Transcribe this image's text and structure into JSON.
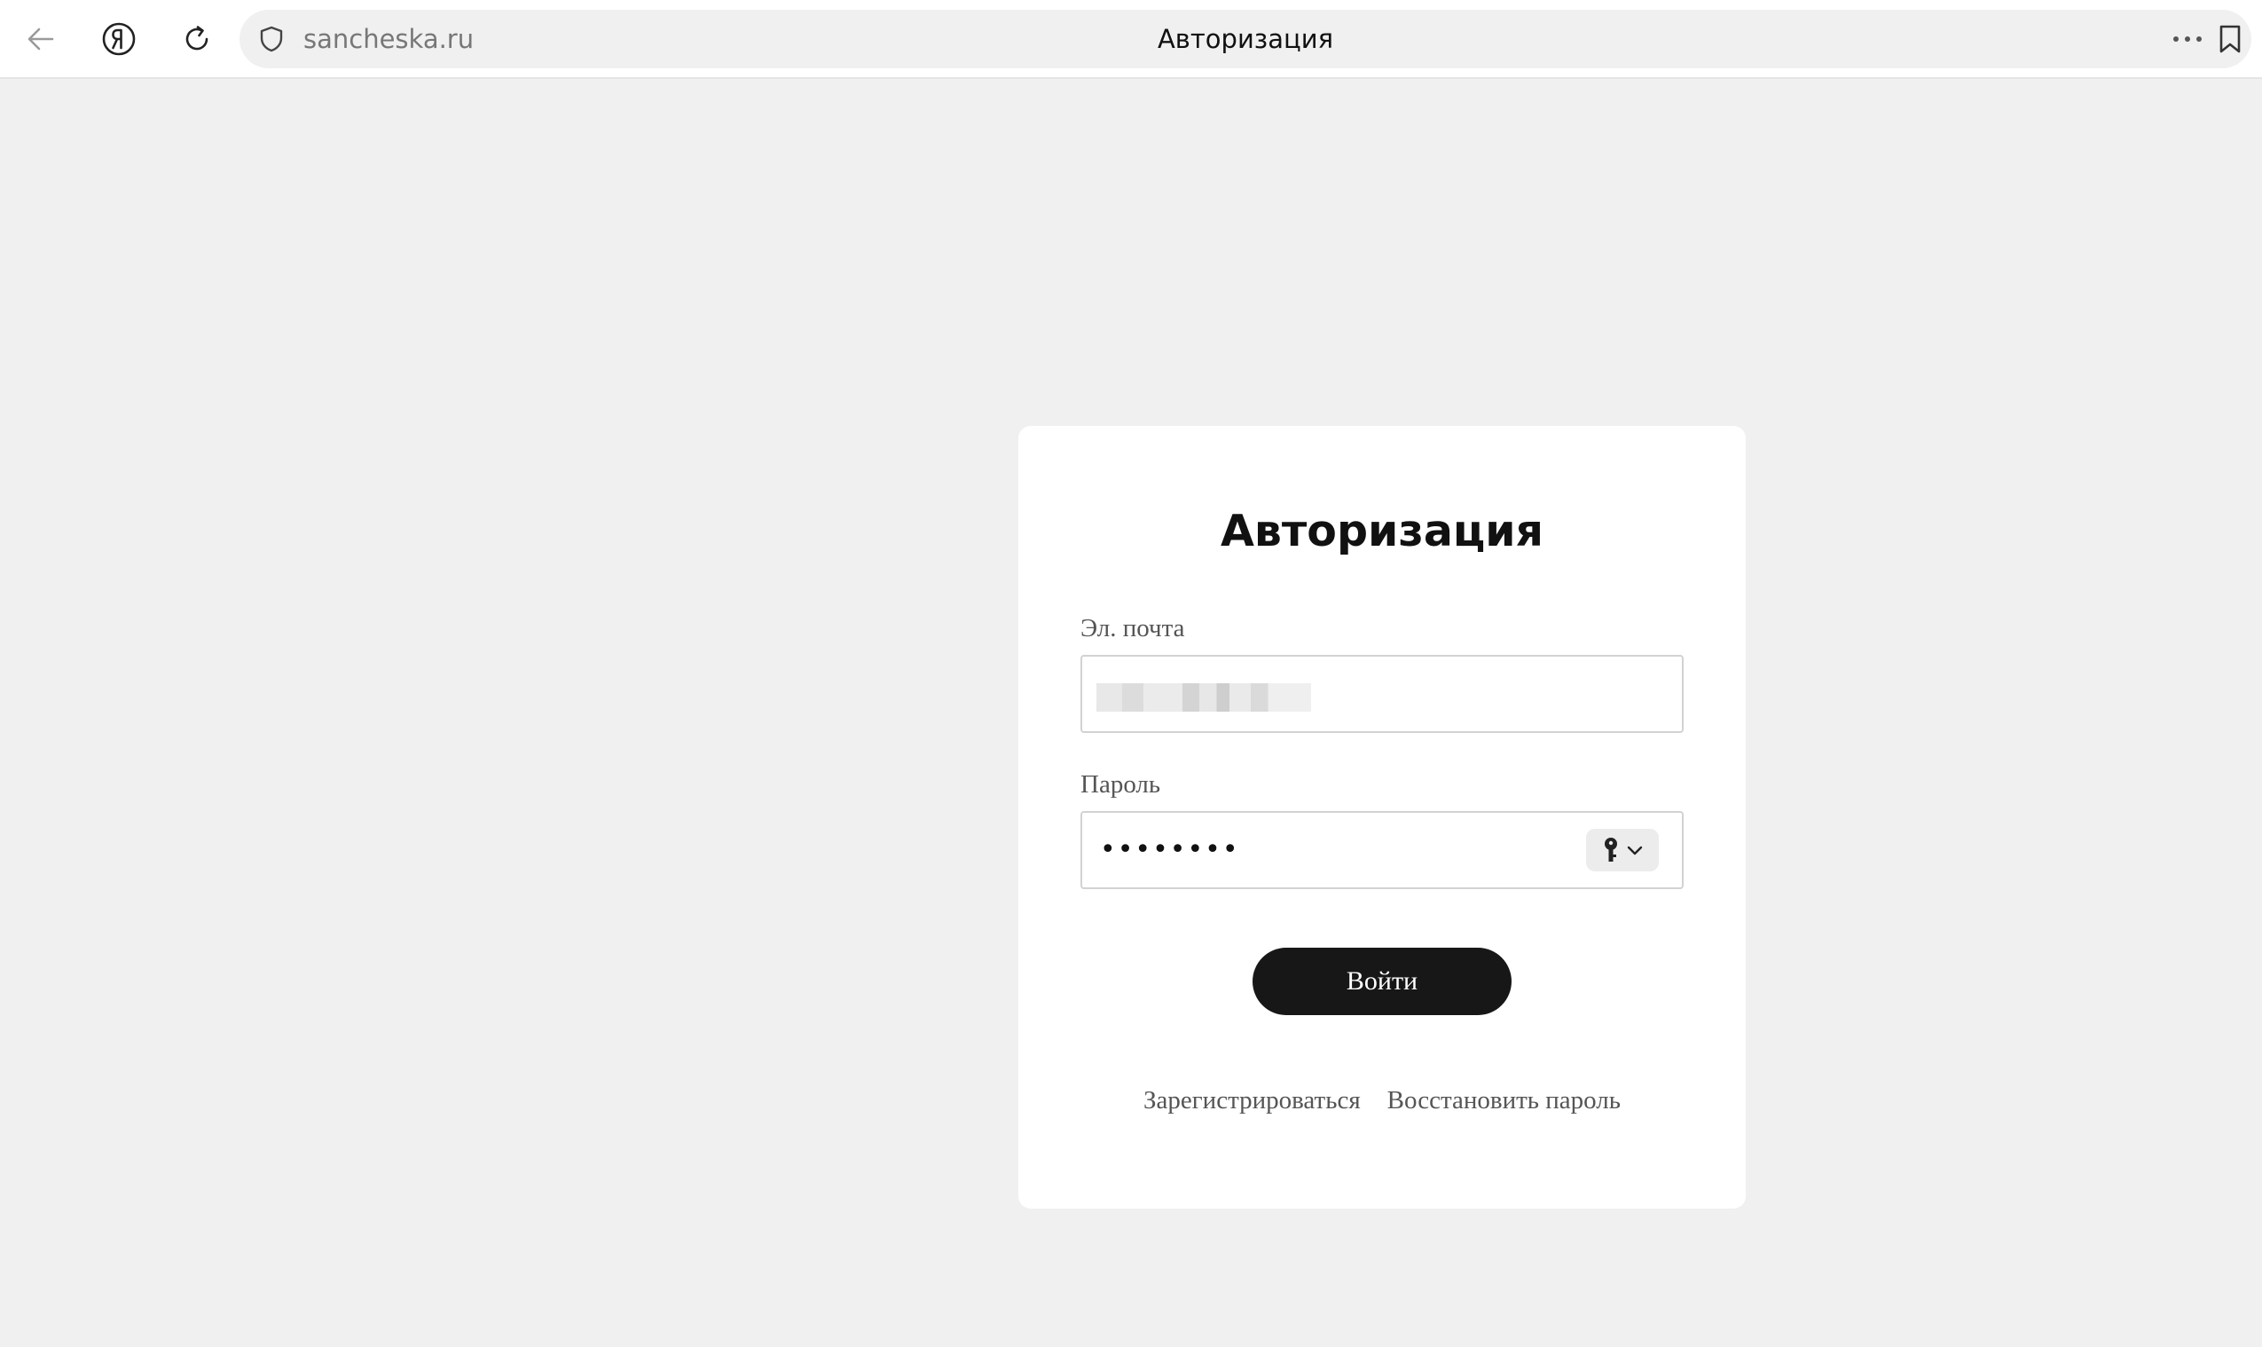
{
  "browser": {
    "url": "sancheska.ru",
    "page_title": "Авторизация",
    "icons": {
      "back": "arrow-left-icon",
      "yandex": "yandex-logo-icon",
      "reload": "reload-icon",
      "security": "shield-icon",
      "more": "more-dots-icon",
      "bookmark": "bookmark-icon"
    }
  },
  "form": {
    "title": "Авторизация",
    "email_label": "Эл. почта",
    "password_label": "Пароль",
    "password_value_masked": "••••••••",
    "submit_label": "Войти",
    "register_link": "Зарегистрироваться",
    "restore_link": "Восстановить пароль",
    "key_button_icon": "key-icon"
  },
  "colors": {
    "page_background": "#f0f0f0",
    "card_background": "#ffffff",
    "button_background": "#171717",
    "button_text": "#ffffff"
  }
}
